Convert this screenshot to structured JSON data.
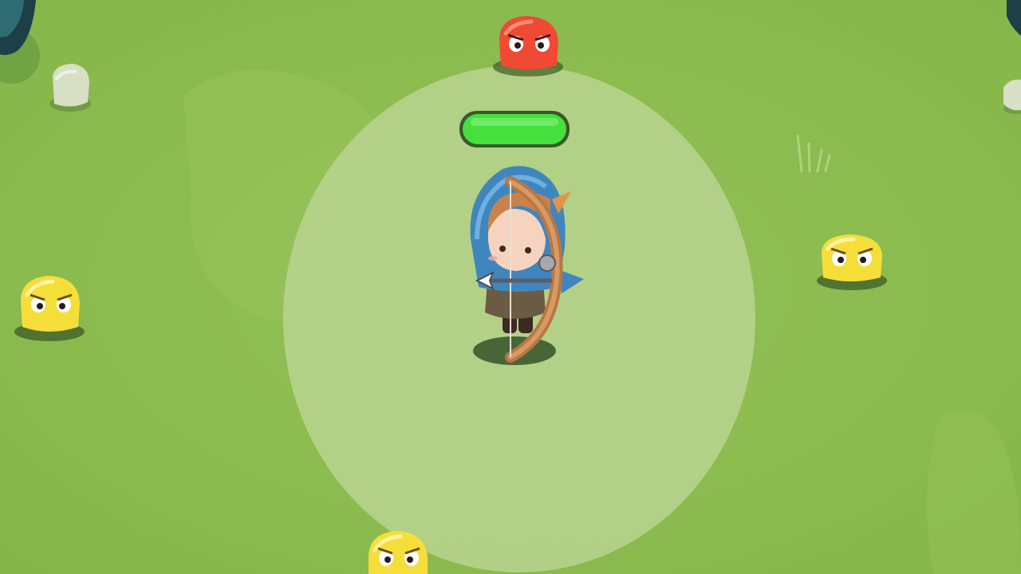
{
  "game": {
    "player": {
      "character": "hooded-archer",
      "health_fraction": 1.0,
      "health_color": "#46e03e",
      "range_indicator": "attack-range-circle"
    },
    "enemies": [
      {
        "kind": "slime",
        "color": "red",
        "hex": "#f04a34"
      },
      {
        "kind": "slime",
        "color": "yellow",
        "hex": "#f6de3a"
      },
      {
        "kind": "slime",
        "color": "yellow",
        "hex": "#f6de3a"
      },
      {
        "kind": "slime",
        "color": "yellow",
        "hex": "#f6de3a"
      }
    ],
    "terrain": {
      "ground_color": "#8cbb4e",
      "range_circle_color": "#b6d28e"
    }
  }
}
